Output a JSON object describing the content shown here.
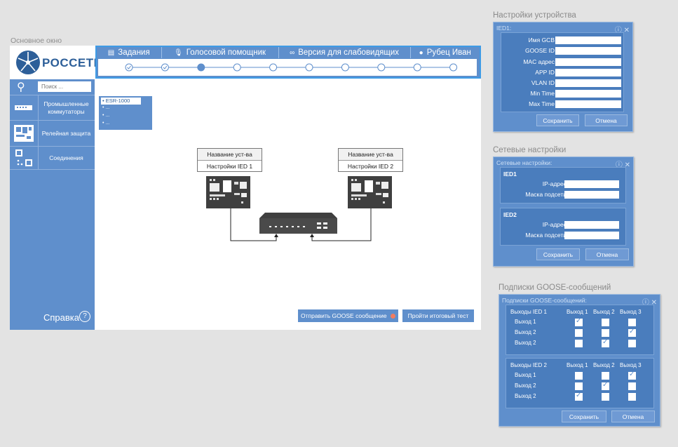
{
  "main_caption": "Основное окно",
  "logo_text": "РОССЕТИ",
  "search": {
    "placeholder": "Поиск ..."
  },
  "sidebar": {
    "items": [
      {
        "label": "Промышленные коммутаторы",
        "icon": "switch-icon"
      },
      {
        "label": "Релейная защита",
        "icon": "relay-icon"
      },
      {
        "label": "Соединения",
        "icon": "connections-icon"
      }
    ],
    "help": "Справка"
  },
  "tabs": [
    {
      "label": "Задания",
      "icon": "tasks-icon"
    },
    {
      "label": "Голосовой помощник",
      "icon": "mic-icon"
    },
    {
      "label": "Версия для слабовидящих",
      "icon": "glasses-icon"
    },
    {
      "label": "Рубец Иван",
      "icon": "user-icon"
    }
  ],
  "progress_steps": [
    {
      "state": "done"
    },
    {
      "state": "done"
    },
    {
      "state": "current"
    },
    {
      "state": "todo"
    },
    {
      "state": "todo"
    },
    {
      "state": "todo"
    },
    {
      "state": "todo"
    },
    {
      "state": "todo"
    },
    {
      "state": "todo"
    },
    {
      "state": "todo"
    }
  ],
  "device_list": {
    "selected": "ESR-1000",
    "items": [
      "...",
      "...",
      "..."
    ]
  },
  "devices": [
    {
      "name": "Название уст-ва",
      "settings": "Настройки IED 1"
    },
    {
      "name": "Название уст-ва",
      "settings": "Настройки IED 2"
    }
  ],
  "actions": {
    "send_goose": "Отправить GOOSE сообщение",
    "final_test": "Пройти итоговый тест"
  },
  "device_settings": {
    "caption": "Настройки устройства",
    "title": "IED1:",
    "fields": [
      "Имя GCB",
      "GOOSE ID",
      "MAC адрес",
      "APP ID",
      "VLAN ID",
      "Min Time",
      "Max Time"
    ],
    "save": "Сохранить",
    "cancel": "Отмена"
  },
  "network_settings": {
    "caption": "Сетевые настройки",
    "title": "Сетевые настройки:",
    "groups": [
      {
        "name": "IED1",
        "ip": "IP-адрес",
        "mask": "Маска подсети"
      },
      {
        "name": "IED2",
        "ip": "IP-адрес",
        "mask": "Маска подсети"
      }
    ],
    "save": "Сохранить",
    "cancel": "Отмена"
  },
  "goose_subs": {
    "caption": "Подписки GOOSE-сообщений",
    "title": "Подписки GOOSE-сообщений:",
    "columns": [
      "Выход 1",
      "Выход 2",
      "Выход 3"
    ],
    "blocks": [
      {
        "header": "Выходы IED 1",
        "rows": [
          {
            "label": "Выход 1",
            "checks": [
              true,
              false,
              false
            ]
          },
          {
            "label": "Выход 2",
            "checks": [
              false,
              false,
              true
            ]
          },
          {
            "label": "Выход 2",
            "checks": [
              false,
              true,
              false
            ]
          }
        ]
      },
      {
        "header": "Выходы IED 2",
        "rows": [
          {
            "label": "Выход 1",
            "checks": [
              false,
              false,
              true
            ]
          },
          {
            "label": "Выход 2",
            "checks": [
              false,
              true,
              false
            ]
          },
          {
            "label": "Выход 2",
            "checks": [
              true,
              false,
              false
            ]
          }
        ]
      }
    ],
    "save": "Сохранить",
    "cancel": "Отмена"
  },
  "colors": {
    "accent": "#5f8fcc",
    "highlight": "#3e9be6",
    "send_dot": "#f07c60"
  }
}
